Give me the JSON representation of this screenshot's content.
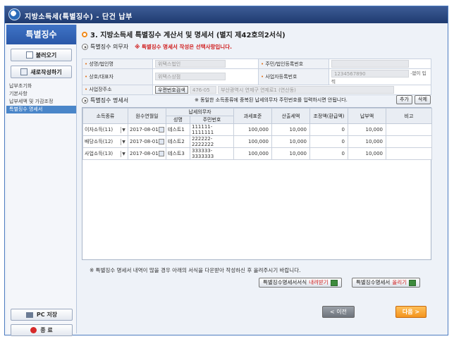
{
  "window": {
    "title": "지방소득세(특별징수) - 단건 납부"
  },
  "sidebar": {
    "header": "특별징수",
    "load_button": "불러오기",
    "new_button": "새로작성하기",
    "menu": [
      "납부초기화",
      "기본사항",
      "납부세액 및 가감조정",
      "특별징수 명세서"
    ],
    "active_index": 3,
    "pc_save": "PC 저장",
    "exit": "종 료"
  },
  "main": {
    "heading": "3. 지방소득세 특별징수 계산서 및 명세서 (별지 제42호의2서식)",
    "section_agent": "특별징수 의무자",
    "agent_warning": "※ 특별징수 명세서 작성은 선택사항입니다.",
    "info": {
      "name_label": "성명/법인명",
      "name_value": "위택스법인",
      "rrn_label": "주민/법인등록번호",
      "trade_label": "상호/대표자",
      "trade_value": "위택스상점",
      "bizno_label": "사업자등록번호",
      "bizno_value": "1234567890",
      "bizno_note": "-없이 입력",
      "addr_label": "사업장주소",
      "zip_button": "우편번호검색",
      "zip_value": "476-05",
      "addr_value": "부산광역시 연제구 연제로1 (연산동)"
    },
    "section_detail": "특별징수 명세서",
    "detail_notice": "※ 동일한 소득종류에 중복된 납세의무자 주민번호를 입력하시면 안됩니다.",
    "add_button": "추가",
    "delete_button": "삭제",
    "grid": {
      "headers": {
        "income_type": "소득종류",
        "pay_date": "원수연월일",
        "taxpayer": "납세의무자",
        "name": "성명",
        "rrn": "주민번호",
        "tax_base": "과세표준",
        "calc_tax": "산출세액",
        "adjust": "조정액(환급액)",
        "payment": "납부액",
        "remark": "비고"
      },
      "rows": [
        {
          "income_type": "이자소득(11)",
          "pay_date": "2017-08-01",
          "name": "테스트1",
          "rrn": "111111-1111111",
          "tax_base": "100,000",
          "calc_tax": "10,000",
          "adjust": "0",
          "payment": "10,000",
          "remark": ""
        },
        {
          "income_type": "배당소득(12)",
          "pay_date": "2017-08-01",
          "name": "테스트2",
          "rrn": "222222-2222222",
          "tax_base": "100,000",
          "calc_tax": "10,000",
          "adjust": "0",
          "payment": "10,000",
          "remark": ""
        },
        {
          "income_type": "사업소득(13)",
          "pay_date": "2017-08-01",
          "name": "테스트3",
          "rrn": "333333-3333333",
          "tax_base": "100,000",
          "calc_tax": "10,000",
          "adjust": "0",
          "payment": "10,000",
          "remark": ""
        }
      ]
    },
    "bottom_note": "※ 특별징수 명세서 내역이 많을 경우 아래의 서식을 다운받아 작성하신 후 올려주시기 바랍니다.",
    "download_prefix": "특별징수명세서서식",
    "download_red": "내려받기",
    "upload_prefix": "특별징수명세서",
    "upload_red": "올리기",
    "prev_button": "< 이전",
    "next_button": "다음 >"
  },
  "colors": {
    "titlebar": "#1f3b70",
    "sidebar_header": "#2a58a8",
    "warning": "#d02020",
    "next": "#f3941e"
  }
}
